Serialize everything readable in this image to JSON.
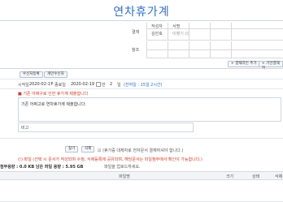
{
  "page": {
    "title": "연차휴가계"
  },
  "approval": {
    "section_label": "결재",
    "col1_header": "작성자",
    "col2_header": "서명",
    "col1_value": "김민호",
    "col2_value": "이병기 (I)"
  },
  "reference": {
    "label": "참조"
  },
  "buttons": {
    "add_approver": "결재라인 추가",
    "add_reference": "기안결재자",
    "select_approver": "수신처등록",
    "personal_receiver": "개인수신처",
    "file_attach": "찾기",
    "file_delete": "삭제"
  },
  "period": {
    "start_label": "시작일",
    "start_value": "2020-02-17",
    "end_label": "종료일",
    "end_value": "2020-02-19",
    "half_day": "반",
    "days_value": "2",
    "unit": "일",
    "remaining": "(잔여일 : 15일 2시간)"
  },
  "body": {
    "notice_line": "기존 어쩌구로 인한 휴가계 제출합니다",
    "content_line": "기존 어쩌고로 연차휴가계 제출합니다.",
    "memo_label": "비고"
  },
  "attach": {
    "hint": "(휴가증 대체자로 전자문서 결재하셔야 합니다.)",
    "warning": "(!) 파일 (선택 시 문서가 작성되며 수정, 삭제등록에 공유되며, 해당문서는 파일첨부에서 확인이 가능합니다.)",
    "capacity": "첨부용량 : 0.0 KB 남은 파일 용량 : 5.95 GB",
    "drop_hint": "파일을 업로드하세요.",
    "table_headers": [
      "파일명",
      "크기",
      "상태",
      "삭제"
    ]
  }
}
